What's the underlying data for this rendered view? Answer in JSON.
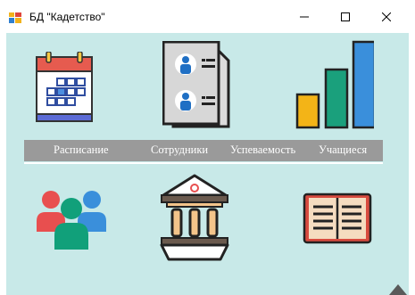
{
  "window": {
    "title": "БД \"Кадетство\"",
    "icons": [
      "app-icon",
      "minimize-icon",
      "maximize-icon",
      "close-icon"
    ]
  },
  "main": {
    "labels": {
      "schedule": "Расписание",
      "staff": "Сотрудники",
      "performance": "Успеваемость",
      "students": "Учащиеся"
    },
    "icons": [
      "calendar-icon",
      "staff-cards-icon",
      "bar-chart-icon",
      "people-group-icon",
      "institution-building-icon",
      "open-book-icon",
      "diamond-icon"
    ],
    "colors": {
      "background": "#c8e9e8",
      "label_bar": "#9a9a9a"
    }
  }
}
